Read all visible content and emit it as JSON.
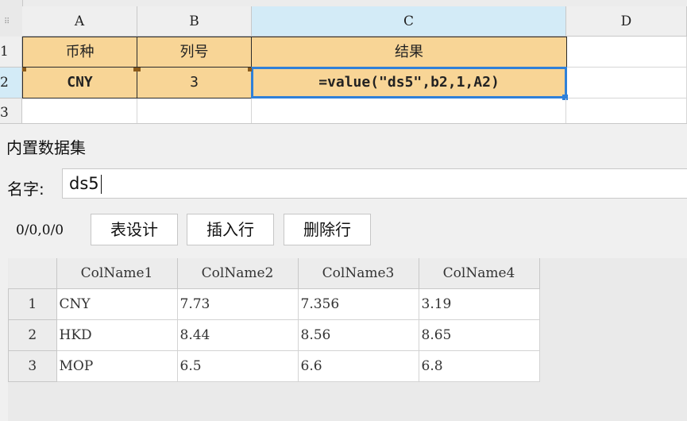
{
  "spreadsheet": {
    "columns": [
      "A",
      "B",
      "C",
      "D"
    ],
    "rows": [
      "1",
      "2",
      "3"
    ],
    "row1": {
      "a": "币种",
      "b": "列号",
      "c": "结果"
    },
    "row2": {
      "a": "CNY",
      "b": "3",
      "c": "=value(\"ds5\",b2,1,A2)"
    }
  },
  "dialog": {
    "title": "内置数据集",
    "name_label": "名字:",
    "name_value": "ds5",
    "position": "0/0,0/0",
    "buttons": {
      "design": "表设计",
      "insert": "插入行",
      "delete": "删除行"
    },
    "table": {
      "headers": [
        "ColName1",
        "ColName2",
        "ColName3",
        "ColName4"
      ],
      "rows": [
        {
          "num": "1",
          "cells": [
            "CNY",
            "7.73",
            "7.356",
            "3.19"
          ]
        },
        {
          "num": "2",
          "cells": [
            "HKD",
            "8.44",
            "8.56",
            "8.65"
          ]
        },
        {
          "num": "3",
          "cells": [
            "MOP",
            "6.5",
            "6.6",
            "6.8"
          ]
        }
      ]
    }
  },
  "colors": {
    "header_fill": "#f8d596",
    "selection_blue": "#2f80d8",
    "selected_header": "#d3ebf7"
  }
}
